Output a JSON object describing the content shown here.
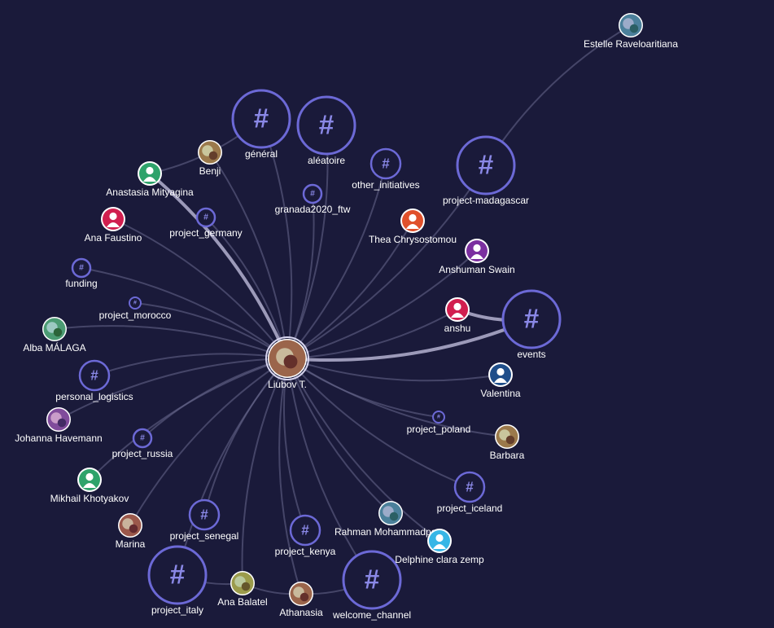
{
  "colors": {
    "background": "#1a1a3a",
    "channel": "#6c69d6",
    "edge": "#6a6a8e",
    "edge_strong": "#b4b2d0",
    "label": "#ffffff"
  },
  "center": {
    "id": "liubov",
    "label": "Liubov T.",
    "kind": "person",
    "icon": "user-photo-avatar"
  },
  "nodes": [
    {
      "id": "general",
      "label": "général",
      "kind": "channel",
      "size": "large"
    },
    {
      "id": "aleatoire",
      "label": "aléatoire",
      "kind": "channel",
      "size": "large"
    },
    {
      "id": "project_madagascar",
      "label": "project-madagascar",
      "kind": "channel",
      "size": "large"
    },
    {
      "id": "events",
      "label": "events",
      "kind": "channel",
      "size": "large"
    },
    {
      "id": "project_italy",
      "label": "project_italy",
      "kind": "channel",
      "size": "large"
    },
    {
      "id": "welcome_channel",
      "label": "welcome_channel",
      "kind": "channel",
      "size": "large"
    },
    {
      "id": "other_initiatives",
      "label": "other_initiatives",
      "kind": "channel",
      "size": "medium"
    },
    {
      "id": "granada2020_ftw",
      "label": "granada2020_ftw",
      "kind": "channel",
      "size": "small"
    },
    {
      "id": "project_germany",
      "label": "project_germany",
      "kind": "channel",
      "size": "small"
    },
    {
      "id": "funding",
      "label": "funding",
      "kind": "channel",
      "size": "small"
    },
    {
      "id": "project_morocco",
      "label": "project_morocco",
      "kind": "channel",
      "size": "tiny"
    },
    {
      "id": "personal_logistics",
      "label": "personal_logistics",
      "kind": "channel",
      "size": "medium"
    },
    {
      "id": "project_russia",
      "label": "project_russia",
      "kind": "channel",
      "size": "small"
    },
    {
      "id": "project_senegal",
      "label": "project_senegal",
      "kind": "channel",
      "size": "medium"
    },
    {
      "id": "project_kenya",
      "label": "project_kenya",
      "kind": "channel",
      "size": "medium"
    },
    {
      "id": "project_iceland",
      "label": "project_iceland",
      "kind": "channel",
      "size": "medium"
    },
    {
      "id": "project_poland",
      "label": "project_poland",
      "kind": "channel",
      "size": "tiny"
    },
    {
      "id": "estelle",
      "label": "Estelle Raveloaritiana",
      "kind": "person",
      "icon": "user-photo-avatar"
    },
    {
      "id": "benji",
      "label": "Benji",
      "kind": "person",
      "icon": "user-photo-avatar"
    },
    {
      "id": "anastasia",
      "label": "Anastasia Mityagina",
      "kind": "person",
      "icon": "user-default-avatar",
      "color": "#2ea36b"
    },
    {
      "id": "ana_faustino",
      "label": "Ana Faustino",
      "kind": "person",
      "icon": "user-default-avatar",
      "color": "#d11f4f"
    },
    {
      "id": "thea",
      "label": "Thea Chrysostomou",
      "kind": "person",
      "icon": "user-default-avatar",
      "color": "#e0502b"
    },
    {
      "id": "anshuman",
      "label": "Anshuman Swain",
      "kind": "person",
      "icon": "user-default-avatar",
      "color": "#7b2fa0"
    },
    {
      "id": "anshu",
      "label": "anshu",
      "kind": "person",
      "icon": "user-default-avatar",
      "color": "#d11f4f"
    },
    {
      "id": "valentina",
      "label": "Valentina",
      "kind": "person",
      "icon": "user-default-avatar",
      "color": "#1f4e8a"
    },
    {
      "id": "alba",
      "label": "Alba MÁLAGA",
      "kind": "person",
      "icon": "user-photo-avatar"
    },
    {
      "id": "johanna",
      "label": "Johanna Havemann",
      "kind": "person",
      "icon": "user-photo-avatar"
    },
    {
      "id": "mikhail",
      "label": "Mikhail Khotyakov",
      "kind": "person",
      "icon": "user-default-avatar",
      "color": "#2ea36b"
    },
    {
      "id": "marina",
      "label": "Marina",
      "kind": "person",
      "icon": "user-photo-avatar"
    },
    {
      "id": "ana_balatel",
      "label": "Ana Balatel",
      "kind": "person",
      "icon": "user-photo-avatar"
    },
    {
      "id": "athanasia",
      "label": "Athanasia",
      "kind": "person",
      "icon": "user-photo-avatar"
    },
    {
      "id": "rahman",
      "label": "Rahman Mohammadpour",
      "kind": "person",
      "icon": "user-photo-avatar"
    },
    {
      "id": "delphine",
      "label": "Delphine clara zemp",
      "kind": "person",
      "icon": "user-default-avatar",
      "color": "#37b6e6"
    },
    {
      "id": "barbara",
      "label": "Barbara",
      "kind": "person",
      "icon": "user-photo-avatar"
    }
  ],
  "edges": [
    {
      "from": "liubov",
      "to": "general"
    },
    {
      "from": "liubov",
      "to": "aleatoire"
    },
    {
      "from": "liubov",
      "to": "project_madagascar"
    },
    {
      "from": "liubov",
      "to": "events",
      "strong": true
    },
    {
      "from": "liubov",
      "to": "project_italy"
    },
    {
      "from": "liubov",
      "to": "welcome_channel"
    },
    {
      "from": "liubov",
      "to": "other_initiatives"
    },
    {
      "from": "liubov",
      "to": "granada2020_ftw"
    },
    {
      "from": "liubov",
      "to": "project_germany"
    },
    {
      "from": "liubov",
      "to": "funding"
    },
    {
      "from": "liubov",
      "to": "project_morocco"
    },
    {
      "from": "liubov",
      "to": "personal_logistics"
    },
    {
      "from": "liubov",
      "to": "project_russia"
    },
    {
      "from": "liubov",
      "to": "project_senegal"
    },
    {
      "from": "liubov",
      "to": "project_kenya"
    },
    {
      "from": "liubov",
      "to": "project_iceland"
    },
    {
      "from": "liubov",
      "to": "project_poland"
    },
    {
      "from": "liubov",
      "to": "benji"
    },
    {
      "from": "liubov",
      "to": "anastasia",
      "strong": true
    },
    {
      "from": "liubov",
      "to": "ana_faustino"
    },
    {
      "from": "liubov",
      "to": "thea"
    },
    {
      "from": "liubov",
      "to": "anshuman"
    },
    {
      "from": "liubov",
      "to": "anshu"
    },
    {
      "from": "liubov",
      "to": "valentina"
    },
    {
      "from": "liubov",
      "to": "alba"
    },
    {
      "from": "liubov",
      "to": "johanna"
    },
    {
      "from": "liubov",
      "to": "mikhail"
    },
    {
      "from": "liubov",
      "to": "marina"
    },
    {
      "from": "liubov",
      "to": "ana_balatel"
    },
    {
      "from": "liubov",
      "to": "athanasia"
    },
    {
      "from": "liubov",
      "to": "rahman"
    },
    {
      "from": "liubov",
      "to": "delphine"
    },
    {
      "from": "liubov",
      "to": "barbara"
    },
    {
      "from": "estelle",
      "to": "project_madagascar"
    },
    {
      "from": "anastasia",
      "to": "general"
    },
    {
      "from": "anshu",
      "to": "events",
      "strong": true
    },
    {
      "from": "project_italy",
      "to": "ana_balatel"
    },
    {
      "from": "ana_balatel",
      "to": "athanasia"
    },
    {
      "from": "athanasia",
      "to": "welcome_channel"
    }
  ]
}
